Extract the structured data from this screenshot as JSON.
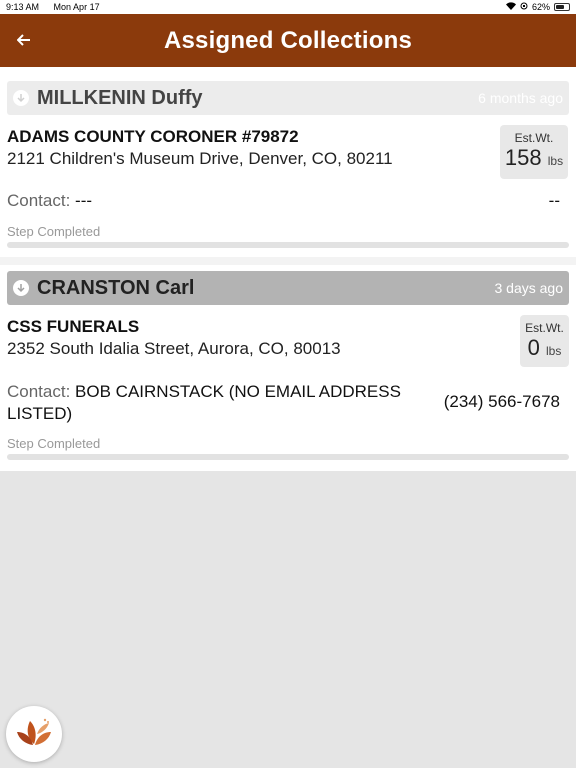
{
  "status_bar": {
    "time": "9:13 AM",
    "date": "Mon Apr 17",
    "battery": "62%"
  },
  "header": {
    "title": "Assigned Collections"
  },
  "collections": [
    {
      "name": "MILLKENIN Duffy",
      "time_ago": "6 months ago",
      "header_color": "#ececec",
      "company": "ADAMS COUNTY CORONER #79872",
      "address": "2121 Children's Museum Drive, Denver, CO, 80211",
      "est_wt_label": "Est.Wt.",
      "est_wt_value": "158",
      "est_wt_unit": "lbs",
      "contact_label": "Contact:",
      "contact_value": "---",
      "phone": "--",
      "step": "Step Completed",
      "progress": 0
    },
    {
      "name": "CRANSTON Carl",
      "time_ago": "3 days ago",
      "header_color": "#b3b3b3",
      "company": "CSS FUNERALS",
      "address": "2352 South Idalia Street, Aurora, CO, 80013",
      "est_wt_label": "Est.Wt.",
      "est_wt_value": "0",
      "est_wt_unit": "lbs",
      "contact_label": "Contact:",
      "contact_value": "BOB CAIRNSTACK (NO EMAIL ADDRESS LISTED)",
      "phone": "(234) 566-7678",
      "step": "Step Completed",
      "progress": 0
    }
  ],
  "icons": {
    "back": "arrow-left-icon",
    "expand": "arrow-down-circle-icon",
    "fab": "leaf-logo-icon"
  },
  "colors": {
    "nav_bar": "#8b3a0c",
    "background": "#e5e5e5"
  }
}
